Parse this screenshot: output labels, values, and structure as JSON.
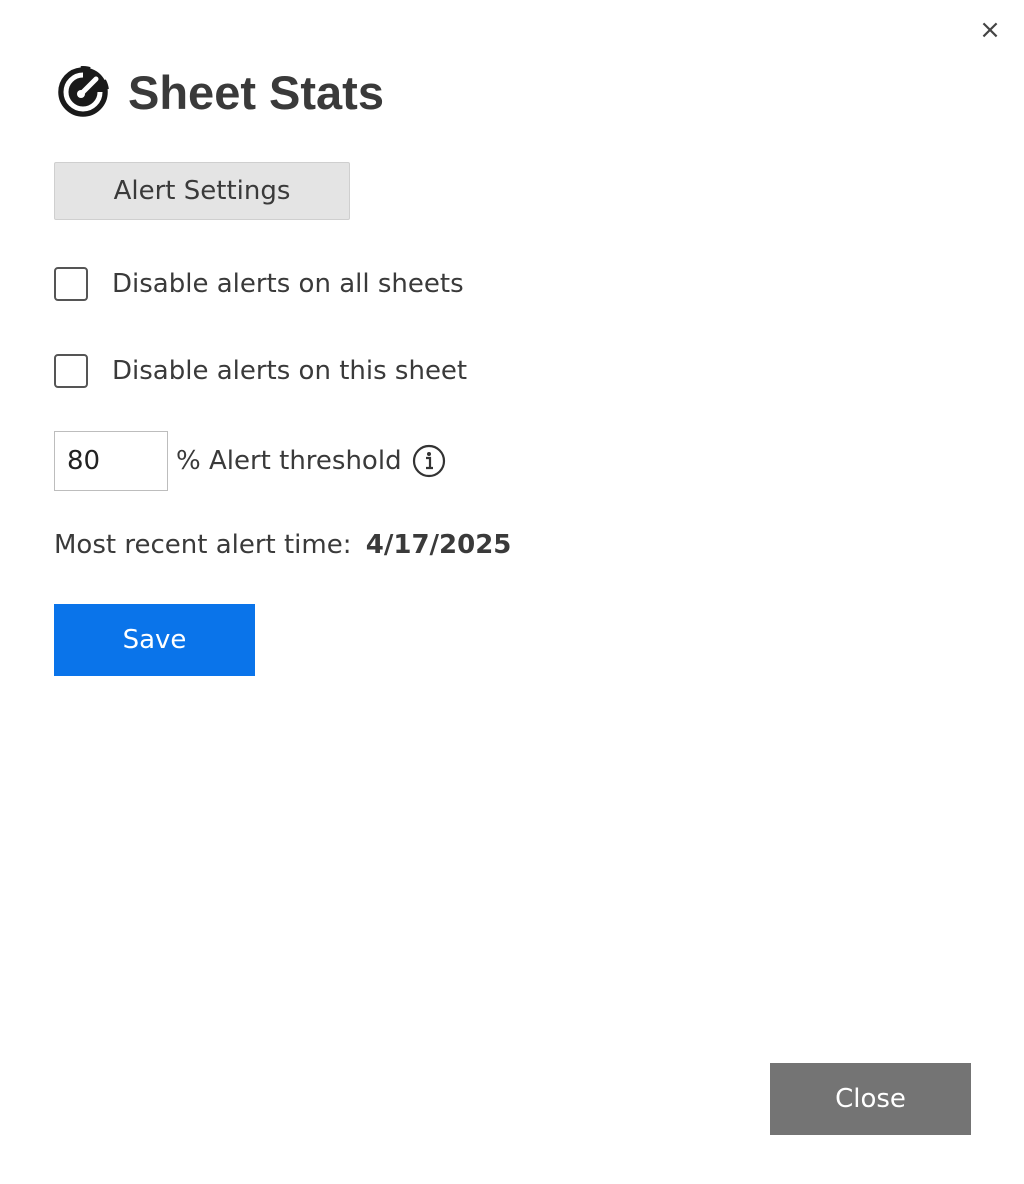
{
  "dialog": {
    "close_icon_glyph": "×",
    "title": "Sheet Stats",
    "logo_icon": "gauge-logo-icon"
  },
  "tabs": {
    "alert_settings_label": "Alert Settings"
  },
  "settings": {
    "disable_all_label": "Disable alerts on all sheets",
    "disable_all_checked": false,
    "disable_this_label": "Disable alerts on this sheet",
    "disable_this_checked": false,
    "threshold_value": "80",
    "threshold_label": "% Alert threshold",
    "info_icon": "info-icon",
    "recent_label": "Most recent alert time:",
    "recent_value": "4/17/2025"
  },
  "actions": {
    "save_label": "Save",
    "close_label": "Close"
  },
  "colors": {
    "save_bg": "#0a74ea",
    "close_bg": "#747474",
    "tab_bg": "#e4e4e4"
  }
}
